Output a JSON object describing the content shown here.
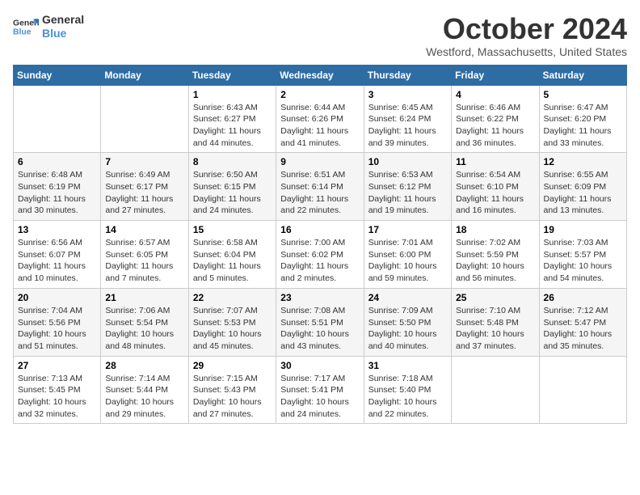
{
  "header": {
    "logo_line1": "General",
    "logo_line2": "Blue",
    "month_title": "October 2024",
    "location": "Westford, Massachusetts, United States"
  },
  "days_of_week": [
    "Sunday",
    "Monday",
    "Tuesday",
    "Wednesday",
    "Thursday",
    "Friday",
    "Saturday"
  ],
  "weeks": [
    [
      {
        "day": "",
        "info": ""
      },
      {
        "day": "",
        "info": ""
      },
      {
        "day": "1",
        "info": "Sunrise: 6:43 AM\nSunset: 6:27 PM\nDaylight: 11 hours and 44 minutes."
      },
      {
        "day": "2",
        "info": "Sunrise: 6:44 AM\nSunset: 6:26 PM\nDaylight: 11 hours and 41 minutes."
      },
      {
        "day": "3",
        "info": "Sunrise: 6:45 AM\nSunset: 6:24 PM\nDaylight: 11 hours and 39 minutes."
      },
      {
        "day": "4",
        "info": "Sunrise: 6:46 AM\nSunset: 6:22 PM\nDaylight: 11 hours and 36 minutes."
      },
      {
        "day": "5",
        "info": "Sunrise: 6:47 AM\nSunset: 6:20 PM\nDaylight: 11 hours and 33 minutes."
      }
    ],
    [
      {
        "day": "6",
        "info": "Sunrise: 6:48 AM\nSunset: 6:19 PM\nDaylight: 11 hours and 30 minutes."
      },
      {
        "day": "7",
        "info": "Sunrise: 6:49 AM\nSunset: 6:17 PM\nDaylight: 11 hours and 27 minutes."
      },
      {
        "day": "8",
        "info": "Sunrise: 6:50 AM\nSunset: 6:15 PM\nDaylight: 11 hours and 24 minutes."
      },
      {
        "day": "9",
        "info": "Sunrise: 6:51 AM\nSunset: 6:14 PM\nDaylight: 11 hours and 22 minutes."
      },
      {
        "day": "10",
        "info": "Sunrise: 6:53 AM\nSunset: 6:12 PM\nDaylight: 11 hours and 19 minutes."
      },
      {
        "day": "11",
        "info": "Sunrise: 6:54 AM\nSunset: 6:10 PM\nDaylight: 11 hours and 16 minutes."
      },
      {
        "day": "12",
        "info": "Sunrise: 6:55 AM\nSunset: 6:09 PM\nDaylight: 11 hours and 13 minutes."
      }
    ],
    [
      {
        "day": "13",
        "info": "Sunrise: 6:56 AM\nSunset: 6:07 PM\nDaylight: 11 hours and 10 minutes."
      },
      {
        "day": "14",
        "info": "Sunrise: 6:57 AM\nSunset: 6:05 PM\nDaylight: 11 hours and 7 minutes."
      },
      {
        "day": "15",
        "info": "Sunrise: 6:58 AM\nSunset: 6:04 PM\nDaylight: 11 hours and 5 minutes."
      },
      {
        "day": "16",
        "info": "Sunrise: 7:00 AM\nSunset: 6:02 PM\nDaylight: 11 hours and 2 minutes."
      },
      {
        "day": "17",
        "info": "Sunrise: 7:01 AM\nSunset: 6:00 PM\nDaylight: 10 hours and 59 minutes."
      },
      {
        "day": "18",
        "info": "Sunrise: 7:02 AM\nSunset: 5:59 PM\nDaylight: 10 hours and 56 minutes."
      },
      {
        "day": "19",
        "info": "Sunrise: 7:03 AM\nSunset: 5:57 PM\nDaylight: 10 hours and 54 minutes."
      }
    ],
    [
      {
        "day": "20",
        "info": "Sunrise: 7:04 AM\nSunset: 5:56 PM\nDaylight: 10 hours and 51 minutes."
      },
      {
        "day": "21",
        "info": "Sunrise: 7:06 AM\nSunset: 5:54 PM\nDaylight: 10 hours and 48 minutes."
      },
      {
        "day": "22",
        "info": "Sunrise: 7:07 AM\nSunset: 5:53 PM\nDaylight: 10 hours and 45 minutes."
      },
      {
        "day": "23",
        "info": "Sunrise: 7:08 AM\nSunset: 5:51 PM\nDaylight: 10 hours and 43 minutes."
      },
      {
        "day": "24",
        "info": "Sunrise: 7:09 AM\nSunset: 5:50 PM\nDaylight: 10 hours and 40 minutes."
      },
      {
        "day": "25",
        "info": "Sunrise: 7:10 AM\nSunset: 5:48 PM\nDaylight: 10 hours and 37 minutes."
      },
      {
        "day": "26",
        "info": "Sunrise: 7:12 AM\nSunset: 5:47 PM\nDaylight: 10 hours and 35 minutes."
      }
    ],
    [
      {
        "day": "27",
        "info": "Sunrise: 7:13 AM\nSunset: 5:45 PM\nDaylight: 10 hours and 32 minutes."
      },
      {
        "day": "28",
        "info": "Sunrise: 7:14 AM\nSunset: 5:44 PM\nDaylight: 10 hours and 29 minutes."
      },
      {
        "day": "29",
        "info": "Sunrise: 7:15 AM\nSunset: 5:43 PM\nDaylight: 10 hours and 27 minutes."
      },
      {
        "day": "30",
        "info": "Sunrise: 7:17 AM\nSunset: 5:41 PM\nDaylight: 10 hours and 24 minutes."
      },
      {
        "day": "31",
        "info": "Sunrise: 7:18 AM\nSunset: 5:40 PM\nDaylight: 10 hours and 22 minutes."
      },
      {
        "day": "",
        "info": ""
      },
      {
        "day": "",
        "info": ""
      }
    ]
  ]
}
